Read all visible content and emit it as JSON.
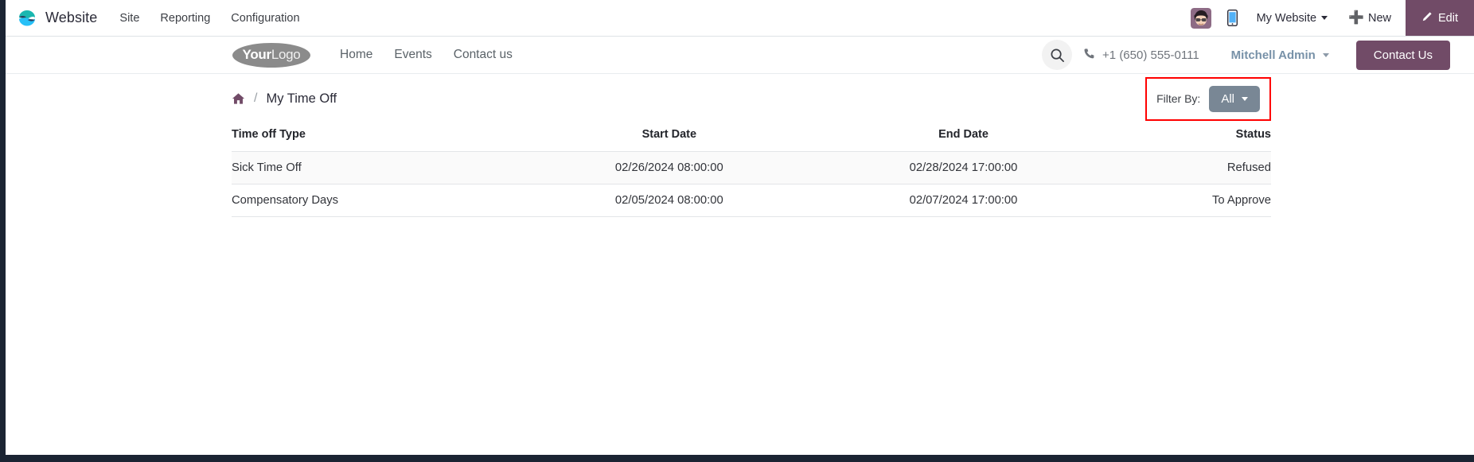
{
  "backend_nav": {
    "brand": "Website",
    "logo_icon": "odoo-logo-icon",
    "menu": [
      {
        "label": "Site"
      },
      {
        "label": "Reporting"
      },
      {
        "label": "Configuration"
      }
    ],
    "avatar_icon": "user-avatar",
    "mobile_icon": "mobile-preview-icon",
    "site_selector": "My Website",
    "new_label": "New",
    "new_icon": "plus-icon",
    "edit_label": "Edit",
    "edit_icon": "pencil-icon",
    "edit_bg": "#714b67"
  },
  "site_header": {
    "logo_your": "Your",
    "logo_logo": "Logo",
    "menu": [
      {
        "label": "Home"
      },
      {
        "label": "Events"
      },
      {
        "label": "Contact us"
      }
    ],
    "search_icon": "search-icon",
    "phone_icon": "phone-icon",
    "phone": "+1 (650) 555-0111",
    "user": "Mitchell Admin",
    "contact_button": "Contact Us",
    "contact_button_bg": "#714b67"
  },
  "breadcrumb": {
    "home_icon": "home-icon",
    "separator": "/",
    "current": "My Time Off"
  },
  "filter": {
    "label": "Filter By:",
    "selected": "All",
    "highlight_color": "#ff0000",
    "dropdown_bg": "#798795"
  },
  "table": {
    "columns": [
      "Time off Type",
      "Start Date",
      "End Date",
      "Status"
    ],
    "rows": [
      {
        "type": "Sick Time Off",
        "start": "02/26/2024 08:00:00",
        "end": "02/28/2024 17:00:00",
        "status": "Refused"
      },
      {
        "type": "Compensatory Days",
        "start": "02/05/2024 08:00:00",
        "end": "02/07/2024 17:00:00",
        "status": "To Approve"
      }
    ]
  }
}
